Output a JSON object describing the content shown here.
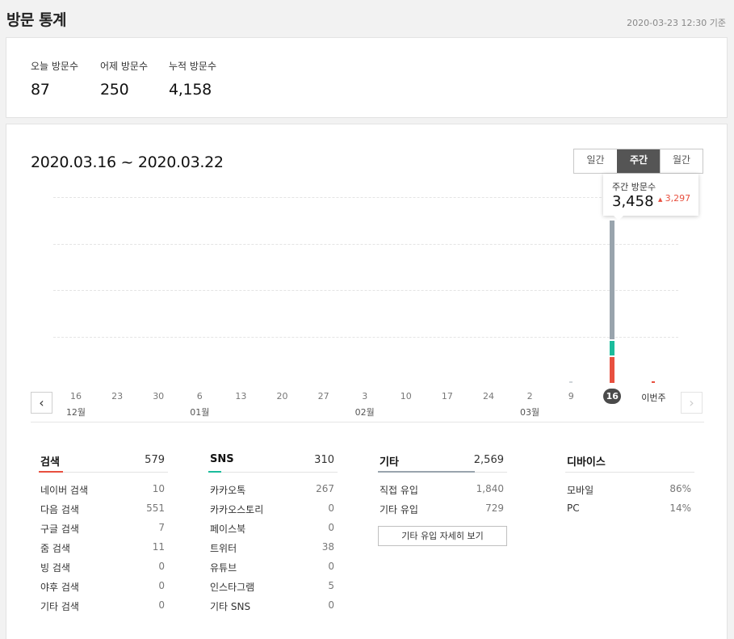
{
  "header": {
    "title": "방문 통계",
    "basis_time": "2020-03-23 12:30 기준"
  },
  "summary": {
    "today": {
      "label": "오늘 방문수",
      "value": "87"
    },
    "yesterday": {
      "label": "어제 방문수",
      "value": "250"
    },
    "total": {
      "label": "누적 방문수",
      "value": "4,158"
    }
  },
  "range": "2020.03.16 ~ 2020.03.22",
  "period_tabs": [
    {
      "label": "일간",
      "active": false
    },
    {
      "label": "주간",
      "active": true
    },
    {
      "label": "월간",
      "active": false
    }
  ],
  "tooltip": {
    "label": "주간 방문수",
    "value": "3,458",
    "change_arrow": "▲",
    "change": "3,297"
  },
  "colors": {
    "search": "#e8503f",
    "sns": "#1bbc9c",
    "other": "#99a4ad",
    "current_badge": "#4a4a4a"
  },
  "chart_data": {
    "type": "bar",
    "stacked": true,
    "categories": [
      "16",
      "23",
      "30",
      "6",
      "13",
      "20",
      "27",
      "3",
      "10",
      "17",
      "24",
      "2",
      "9",
      "16",
      "이번주"
    ],
    "months": [
      {
        "label": "12월",
        "at": "16"
      },
      {
        "label": "01월",
        "at": "6"
      },
      {
        "label": "02월",
        "at": "3"
      },
      {
        "label": "03월",
        "at": "2"
      }
    ],
    "current_index": 13,
    "series": [
      {
        "name": "검색",
        "values": [
          0,
          0,
          0,
          0,
          0,
          0,
          0,
          0,
          0,
          0,
          0,
          0,
          0,
          579,
          20
        ]
      },
      {
        "name": "SNS",
        "values": [
          0,
          0,
          0,
          0,
          0,
          0,
          0,
          0,
          0,
          0,
          0,
          0,
          0,
          310,
          0
        ]
      },
      {
        "name": "기타",
        "values": [
          0,
          0,
          0,
          0,
          0,
          0,
          0,
          0,
          0,
          0,
          0,
          0,
          30,
          2569,
          0
        ]
      }
    ],
    "ylim": [
      0,
      4000
    ]
  },
  "stats": {
    "search": {
      "title": "검색",
      "total": "579",
      "rows": [
        {
          "label": "네이버 검색",
          "value": "10"
        },
        {
          "label": "다음 검색",
          "value": "551"
        },
        {
          "label": "구글 검색",
          "value": "7"
        },
        {
          "label": "줌 검색",
          "value": "11"
        },
        {
          "label": "빙 검색",
          "value": "0"
        },
        {
          "label": "야후 검색",
          "value": "0"
        },
        {
          "label": "기타 검색",
          "value": "0"
        }
      ]
    },
    "sns": {
      "title": "SNS",
      "total": "310",
      "rows": [
        {
          "label": "카카오톡",
          "value": "267"
        },
        {
          "label": "카카오스토리",
          "value": "0"
        },
        {
          "label": "페이스북",
          "value": "0"
        },
        {
          "label": "트위터",
          "value": "38"
        },
        {
          "label": "유튜브",
          "value": "0"
        },
        {
          "label": "인스타그램",
          "value": "5"
        },
        {
          "label": "기타 SNS",
          "value": "0"
        }
      ]
    },
    "other": {
      "title": "기타",
      "total": "2,569",
      "rows": [
        {
          "label": "직접 유입",
          "value": "1,840"
        },
        {
          "label": "기타 유입",
          "value": "729"
        }
      ],
      "detail_button": "기타 유입 자세히 보기"
    },
    "device": {
      "title": "디바이스",
      "rows": [
        {
          "label": "모바일",
          "value": "86%"
        },
        {
          "label": "PC",
          "value": "14%"
        }
      ]
    }
  }
}
